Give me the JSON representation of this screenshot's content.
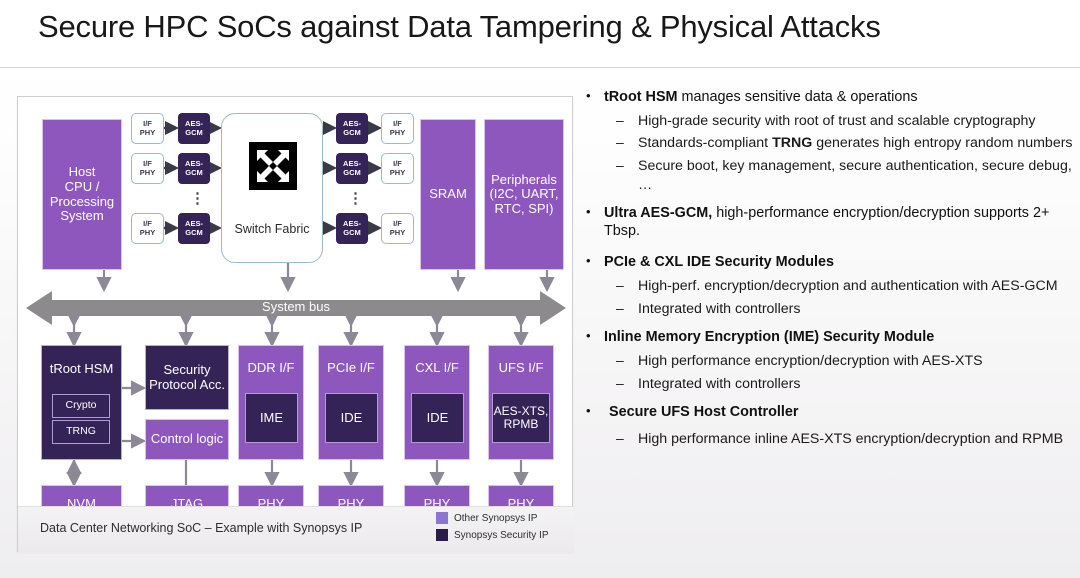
{
  "slide": {
    "title": "Secure HPC SoCs against Data Tampering & Physical Attacks"
  },
  "colors": {
    "other_ip_purple": "#8E57BE",
    "security_ip_dark": "#332357",
    "system_bus_gray": "#8D8A8D",
    "panel_border": "#cfcfcf"
  },
  "diagram": {
    "caption": "Data Center Networking SoC – Example with Synopsys IP",
    "legend": [
      {
        "label": "Other Synopsys IP",
        "color": "#8E74D2"
      },
      {
        "label": "Synopsys Security IP",
        "color": "#2A1B4A"
      }
    ],
    "system_bus_label": "System bus",
    "switch_fabric_label": "Switch Fabric",
    "top_blocks": {
      "host": "Host\nCPU /\nProcessing\nSystem",
      "host_lines": [
        "Host",
        "CPU /",
        "Processing",
        "System"
      ],
      "sram": "SRAM",
      "peripherals_lines": [
        "Peripherals",
        "(I2C, UART,",
        "RTC, SPI)"
      ]
    },
    "io_left": [
      {
        "phy": "I/F\nPHY",
        "phy_lines": [
          "I/F",
          "PHY"
        ],
        "crypto": "AES-\nGCM",
        "crypto_lines": [
          "AES-",
          "GCM"
        ]
      },
      {
        "phy": "I/F\nPHY",
        "phy_lines": [
          "I/F",
          "PHY"
        ],
        "crypto": "AES-\nGCM",
        "crypto_lines": [
          "AES-",
          "GCM"
        ]
      },
      {
        "phy": "I/F\nPHY",
        "phy_lines": [
          "I/F",
          "PHY"
        ],
        "crypto": "AES-\nGCM",
        "crypto_lines": [
          "AES-",
          "GCM"
        ]
      }
    ],
    "io_right": [
      {
        "phy_lines": [
          "I/F",
          "PHY"
        ],
        "crypto_lines": [
          "AES-",
          "GCM"
        ]
      },
      {
        "phy_lines": [
          "I/F",
          "PHY"
        ],
        "crypto_lines": [
          "AES-",
          "GCM"
        ]
      },
      {
        "phy_lines": [
          "I/F",
          "PHY"
        ],
        "crypto_lines": [
          "AES-",
          "GCM"
        ]
      }
    ],
    "ellipsis": "⋮",
    "bottom_blocks": [
      {
        "name": "troot-hsm",
        "label": "tRoot HSM",
        "kind": "security",
        "subblocks": [
          {
            "label": "Crypto"
          },
          {
            "label": "TRNG"
          }
        ]
      },
      {
        "name": "security-protocol-acc",
        "label_lines": [
          "Security",
          "Protocol Acc."
        ],
        "kind": "security"
      },
      {
        "name": "control-logic",
        "label": "Control logic",
        "kind": "other"
      },
      {
        "name": "ddr-if",
        "label": "DDR I/F",
        "kind": "other",
        "sub": "IME",
        "sub_kind": "security"
      },
      {
        "name": "pcie-if",
        "label": "PCIe I/F",
        "kind": "other",
        "sub": "IDE",
        "sub_kind": "security"
      },
      {
        "name": "cxl-if",
        "label": "CXL I/F",
        "kind": "other",
        "sub": "IDE",
        "sub_kind": "security"
      },
      {
        "name": "ufs-if",
        "label": "UFS I/F",
        "kind": "other",
        "sub_lines": [
          "AES-XTS,",
          "RPMB"
        ],
        "sub_kind": "security"
      }
    ],
    "leaf_blocks": [
      {
        "name": "nvm",
        "label": "NVM"
      },
      {
        "name": "jtag",
        "label": "JTAG"
      },
      {
        "name": "phy-ddr",
        "label": "PHY"
      },
      {
        "name": "phy-pcie",
        "label": "PHY"
      },
      {
        "name": "phy-cxl",
        "label": "PHY"
      },
      {
        "name": "phy-ufs",
        "label": "PHY"
      }
    ]
  },
  "bullets": [
    {
      "marker": "•",
      "lead": "tRoot HSM",
      "rest": " manages sensitive data & operations",
      "sub": [
        {
          "marker": "–",
          "text": "High-grade security with root of trust and scalable cryptography"
        },
        {
          "marker": "–",
          "lead_pre": "Standards-compliant ",
          "lead": "TRNG",
          "rest": " generates high entropy random numbers"
        },
        {
          "marker": "–",
          "text": "Secure boot, key management, secure authentication, secure debug, …"
        }
      ]
    },
    {
      "marker": "•",
      "lead": "Ultra AES-GCM,",
      "rest": " high-performance encryption/decryption supports 2+ Tbsp.",
      "sub": []
    },
    {
      "marker": "•",
      "lead": "PCIe & CXL IDE Security Modules",
      "rest": "",
      "sub": [
        {
          "marker": "–",
          "text": "High-perf. encryption/decryption and authentication with AES-GCM"
        },
        {
          "marker": "–",
          "text": "Integrated with controllers"
        }
      ]
    },
    {
      "marker": "•",
      "lead": "Inline Memory Encryption (IME) Security Module",
      "rest": "",
      "sub": [
        {
          "marker": "–",
          "text": "High performance encryption/decryption with AES-XTS"
        },
        {
          "marker": "–",
          "text": "Integrated with controllers"
        }
      ]
    },
    {
      "marker": "•",
      "lead": "Secure UFS Host Controller",
      "rest": "",
      "sub": [
        {
          "marker": "–",
          "text": "High performance inline AES-XTS encryption/decryption and RPMB"
        }
      ]
    }
  ]
}
